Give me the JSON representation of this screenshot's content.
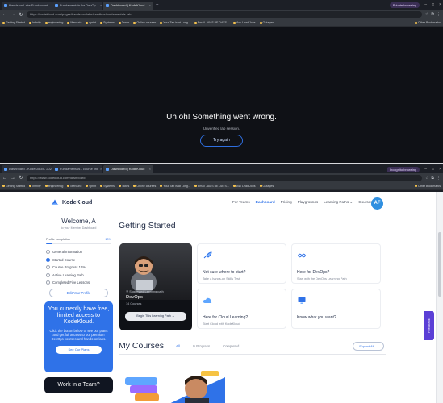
{
  "top_window": {
    "tabs": [
      {
        "label": "Hands on Labs Fundament...",
        "active": false
      },
      {
        "label": "Fundamentals for DevOp...",
        "active": false
      },
      {
        "label": "Dashboard | KodeKloud",
        "active": true
      }
    ],
    "profile": "Private browsing",
    "url": "https://kodekloud.com/pages/hands-on-labs/sandbox/fundamentals-lab",
    "bookmarks": [
      "Getting Started",
      "Infinity",
      "engineering",
      "Mercurio",
      "sprint",
      "Systems",
      "Taxes",
      "Online courses",
      "Your Tab is at Long...",
      "Email - AMS BE DAYS...",
      "Ask Lead Jobs",
      "Outages"
    ],
    "other_bookmarks": "Other Bookmarks",
    "error_title": "Uh oh! Something went wrong.",
    "error_sub": "Unverified lab session.",
    "retry_label": "Try again"
  },
  "bottom_window": {
    "tabs": [
      {
        "label": "Dashboard - KodeKloud - 2025",
        "active": false
      },
      {
        "label": "Fundamentals - course link",
        "active": false
      },
      {
        "label": "Dashboard | KodeKloud",
        "active": true
      }
    ],
    "profile": "Incognito browsing",
    "url": "https://www.kodekloud.com/dashboard",
    "bookmarks": [
      "Getting Started",
      "Infinity",
      "engineering",
      "Mercurio",
      "sprint",
      "Systems",
      "Taxes",
      "Online courses",
      "Your Tab is at Long...",
      "Email - AMS BE DAYS...",
      "Ask Lead Jobs",
      "Outages"
    ],
    "other_bookmarks": "Other Bookmarks"
  },
  "app": {
    "logo": "KodeKloud",
    "nav": [
      "For Teams",
      "Dashboard",
      "Pricing",
      "Playgrounds",
      "Learning Paths",
      "Courses"
    ],
    "nav_active": "Dashboard",
    "avatar_initials": "AF"
  },
  "sidebar": {
    "welcome": "Welcome, A",
    "welcome_sub": "to your Member Dashboard",
    "profile_completion_label": "Profile completion",
    "profile_completion_value": "10%",
    "profile_completion_fraction": 0.1,
    "checklist": [
      {
        "label": "General Information",
        "done": false
      },
      {
        "label": "Started Course",
        "done": true
      },
      {
        "label": "Course Progress 10%",
        "done": false
      },
      {
        "label": "Active Learning Path",
        "done": false
      },
      {
        "label": "Completed Five Lessons",
        "done": false
      }
    ],
    "edit_profile": "Edit Your Profile",
    "promo_title": "You currently have free, limited access to KodeKloud.",
    "promo_body": "Click the button below to see our plans and get full access to our premium DevOps courses and hands-on labs.",
    "promo_button": "See Our Plans",
    "team_title": "Work in a Team?"
  },
  "main": {
    "getting_started": "Getting Started",
    "learning_path": {
      "suggested": "Suggested Learning path",
      "name": "DevOps",
      "count": "14 Courses",
      "button": "Begin This Learning Path →"
    },
    "cards": [
      {
        "title": "Not sure where to start?",
        "sub": "Take a hands-on Skills Test",
        "icon": "rocket-icon"
      },
      {
        "title": "Here for DevOps?",
        "sub": "Start with the DevOps Learning Path",
        "icon": "infinity-icon"
      },
      {
        "title": "Here for Cloud Learning?",
        "sub": "Start Cloud with KodeKloud",
        "icon": "cloud-icon"
      },
      {
        "title": "Know what you want?",
        "sub": "",
        "icon": "monitor-icon"
      }
    ],
    "my_courses": "My Courses",
    "tabs": [
      "All",
      "In Progress",
      "Completed"
    ],
    "tab_active": "All",
    "expand_all": "Expand All ⌄"
  },
  "feedback": "Feedback",
  "colors": {
    "accent": "#2f72e8",
    "dark_bg": "#0f1116",
    "promo_bg": "#2f72e8",
    "feedback_bg": "#5b3fd6"
  }
}
